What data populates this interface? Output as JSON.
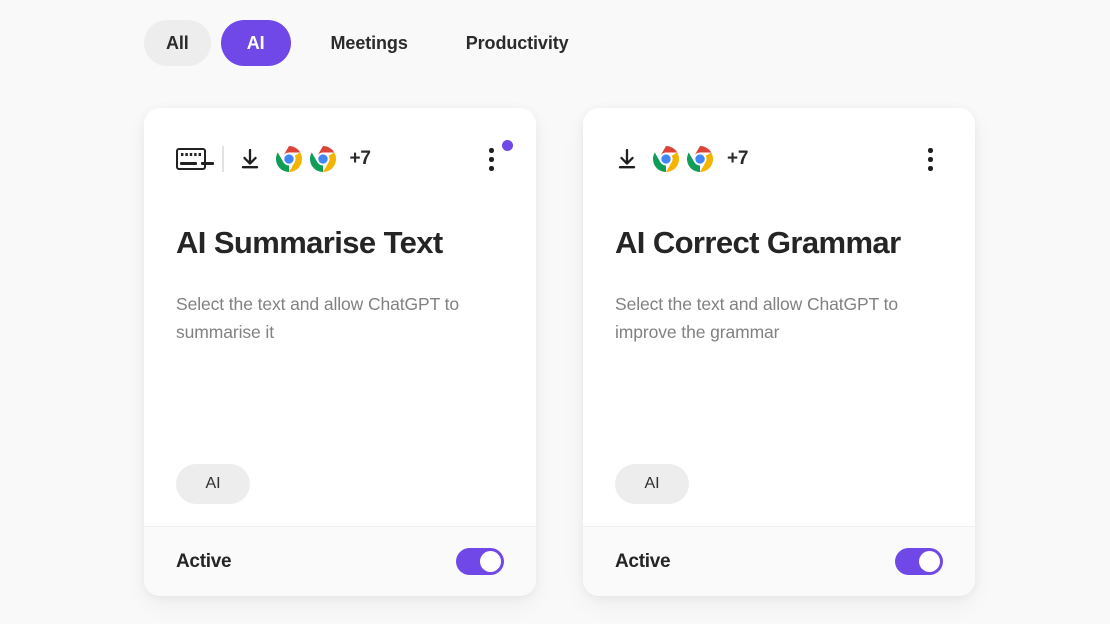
{
  "filters": [
    {
      "label": "All",
      "state": "grey"
    },
    {
      "label": "AI",
      "state": "active"
    },
    {
      "label": "Meetings",
      "state": "plain"
    },
    {
      "label": "Productivity",
      "state": "plain"
    }
  ],
  "colors": {
    "accent": "#7048e8",
    "page_bg": "#f9f9f9",
    "card_bg": "#ffffff",
    "footer_bg": "#fafafa",
    "chip_grey": "#ededed",
    "title": "#252525",
    "body_text": "#818181"
  },
  "cards": [
    {
      "icons": {
        "keyboard": "keyboard-icon",
        "download": "download-icon",
        "browser_1": "chrome-icon",
        "browser_2": "chrome-icon",
        "overflow": "kebab-menu-icon"
      },
      "has_keyboard": true,
      "has_badge": true,
      "more_count": "+7",
      "title": "AI Summarise Text",
      "description": "Select the text and allow ChatGPT to summarise it",
      "tag": "AI",
      "footer_label": "Active",
      "toggle_on": true
    },
    {
      "icons": {
        "download": "download-icon",
        "browser_1": "chrome-icon",
        "browser_2": "chrome-icon",
        "overflow": "kebab-menu-icon"
      },
      "has_keyboard": false,
      "has_badge": false,
      "more_count": "+7",
      "title": "AI Correct Grammar",
      "description": "Select the text and allow ChatGPT to improve the grammar",
      "tag": "AI",
      "footer_label": "Active",
      "toggle_on": true
    }
  ]
}
